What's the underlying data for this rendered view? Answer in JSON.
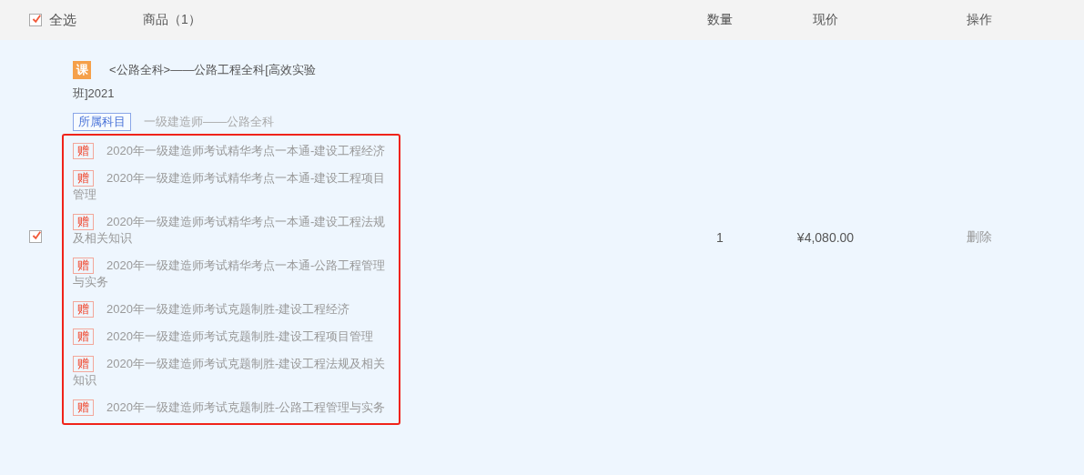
{
  "header": {
    "select_all": {
      "label": "全选",
      "checked": true
    },
    "columns": [
      "商品（1）",
      "数量",
      "现价",
      "操作"
    ]
  },
  "rows": [
    {
      "checked": true,
      "badge": "课",
      "title": "<公路全科>——公路工程全科[高效实验班]2021",
      "category_tag": "所属科目",
      "category": "一级建造师——公路全科",
      "gifts": [
        {
          "badge": "赠",
          "title": "2020年一级建造师考试精华考点一本通-建设工程经济"
        },
        {
          "badge": "赠",
          "title": "2020年一级建造师考试精华考点一本通-建设工程项目管理"
        },
        {
          "badge": "赠",
          "title": "2020年一级建造师考试精华考点一本通-建设工程法规及相关知识"
        },
        {
          "badge": "赠",
          "title": "2020年一级建造师考试精华考点一本通-公路工程管理与实务"
        },
        {
          "badge": "赠",
          "title": "2020年一级建造师考试克题制胜-建设工程经济"
        },
        {
          "badge": "赠",
          "title": "2020年一级建造师考试克题制胜-建设工程项目管理"
        },
        {
          "badge": "赠",
          "title": "2020年一级建造师考试克题制胜-建设工程法规及相关知识"
        },
        {
          "badge": "赠",
          "title": "2020年一级建造师考试克题制胜-公路工程管理与实务"
        }
      ],
      "quantity": "1",
      "price": "¥4,080.00",
      "action": "删除"
    }
  ]
}
